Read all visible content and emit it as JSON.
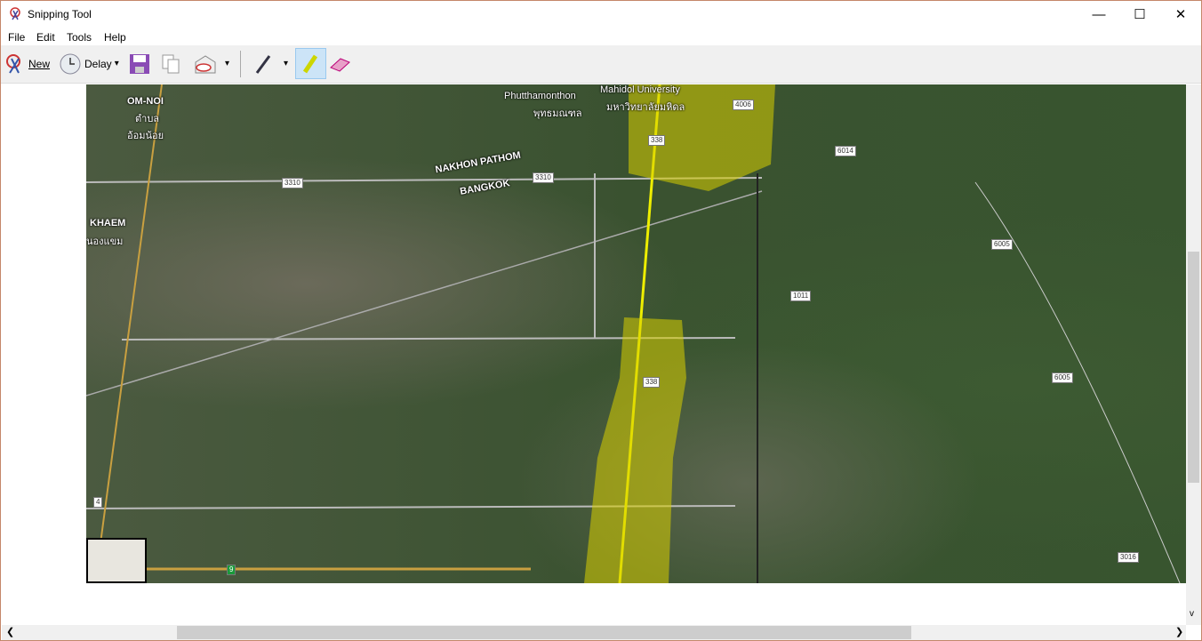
{
  "window": {
    "title": "Snipping Tool",
    "minimize": "—",
    "maximize": "☐",
    "close": "✕"
  },
  "menu": [
    "File",
    "Edit",
    "Tools",
    "Help"
  ],
  "toolbar": {
    "new_label": "New",
    "delay_label": "Delay",
    "dropdown": "▾"
  },
  "map": {
    "places": [
      "OM-NOI",
      "ตำบล",
      "อ้อมน้อย",
      "KHAEM",
      "นองแขม",
      "Phutthamonthon",
      "พุทธมณฑล",
      "Mahidol University",
      "มหาวิทยาลัยมหิดล",
      "NAKHON PATHOM",
      "BANGKOK"
    ],
    "roads": [
      "3310",
      "3310",
      "338",
      "4006",
      "6014",
      "6005",
      "6005",
      "1011",
      "338",
      "4",
      "9",
      "3016"
    ],
    "highlight_color": "#d8d000"
  },
  "scroll": {
    "left": "❮",
    "right": "❯",
    "down": "v"
  }
}
